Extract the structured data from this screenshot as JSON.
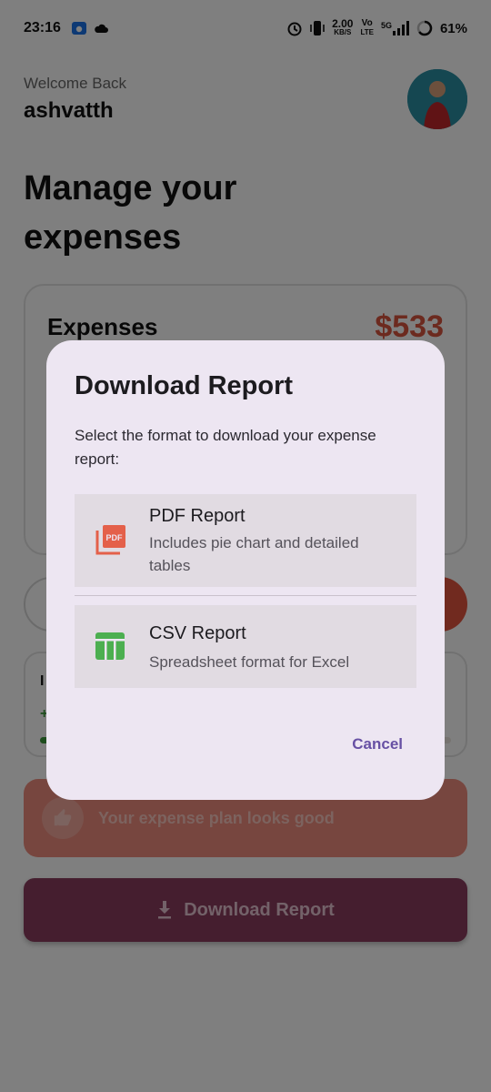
{
  "status_bar": {
    "time": "23:16",
    "net_speed_value": "2.00",
    "net_speed_unit": "KB/S",
    "volte_top": "Vo",
    "volte_bottom": "LTE",
    "network": "5G",
    "battery": "61%"
  },
  "header": {
    "welcome": "Welcome Back",
    "username": "ashvatth",
    "title": "Manage your expenses"
  },
  "expenses_card": {
    "label": "Expenses",
    "amount": "$533"
  },
  "insight_card": {
    "label_partial": "I",
    "plus_partial": "+"
  },
  "advice": {
    "text": "Your expense plan looks good",
    "icon": "thumb-up-icon"
  },
  "download_button": {
    "label": "Download Report",
    "icon": "download-icon"
  },
  "dialog": {
    "title": "Download Report",
    "subtitle": "Select the format to download your expense report:",
    "options": [
      {
        "title": "PDF Report",
        "description": "Includes pie chart and detailed tables",
        "icon": "pdf-icon",
        "icon_color": "#e4604a"
      },
      {
        "title": "CSV Report",
        "description": "Spreadsheet format for Excel",
        "icon": "table-icon",
        "icon_color": "#4caf50"
      }
    ],
    "cancel_label": "Cancel"
  },
  "colors": {
    "accent": "#6750a4",
    "dialog_bg": "#ede6f2",
    "option_bg": "#e1dbe2",
    "expense_red": "#d8543e",
    "download_button": "#8a3d5f"
  }
}
